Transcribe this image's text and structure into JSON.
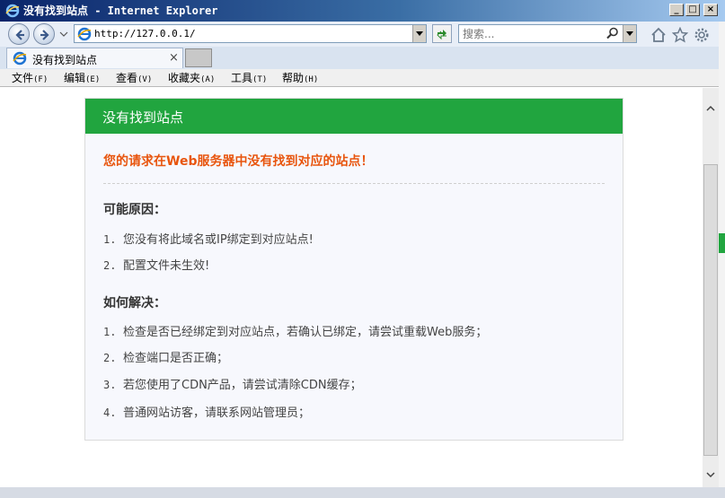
{
  "window": {
    "title": "没有找到站点 - Internet Explorer",
    "buttons": {
      "minimize": "_",
      "maximize": "□",
      "close": "×"
    }
  },
  "toolbar": {
    "address": "http://127.0.0.1/",
    "search_placeholder": "搜索..."
  },
  "tab": {
    "label": "没有找到站点",
    "close": "×"
  },
  "menu": [
    {
      "label": "文件",
      "key": "(F)"
    },
    {
      "label": "编辑",
      "key": "(E)"
    },
    {
      "label": "查看",
      "key": "(V)"
    },
    {
      "label": "收藏夹",
      "key": "(A)"
    },
    {
      "label": "工具",
      "key": "(T)"
    },
    {
      "label": "帮助",
      "key": "(H)"
    }
  ],
  "page": {
    "header": "没有找到站点",
    "alert": "您的请求在Web服务器中没有找到对应的站点！",
    "reasons_title": "可能原因：",
    "reasons": [
      {
        "num": "1.",
        "text": "您没有将此域名或IP绑定到对应站点!"
      },
      {
        "num": "2.",
        "text": "配置文件未生效!"
      }
    ],
    "solutions_title": "如何解决：",
    "solutions": [
      {
        "num": "1.",
        "text": "检查是否已经绑定到对应站点，若确认已绑定，请尝试重载Web服务；"
      },
      {
        "num": "2.",
        "text": "检查端口是否正确；"
      },
      {
        "num": "3.",
        "text": "若您使用了CDN产品，请尝试清除CDN缓存；"
      },
      {
        "num": "4.",
        "text": "普通网站访客，请联系网站管理员；"
      }
    ]
  },
  "colors": {
    "header_green": "#21a53f",
    "alert_orange": "#e8550e",
    "titlebar_blue": "#0a246a"
  },
  "icons": [
    "ie-logo-icon",
    "back-arrow-icon",
    "forward-arrow-icon",
    "refresh-icon",
    "search-icon",
    "home-icon",
    "star-icon",
    "gear-icon"
  ]
}
